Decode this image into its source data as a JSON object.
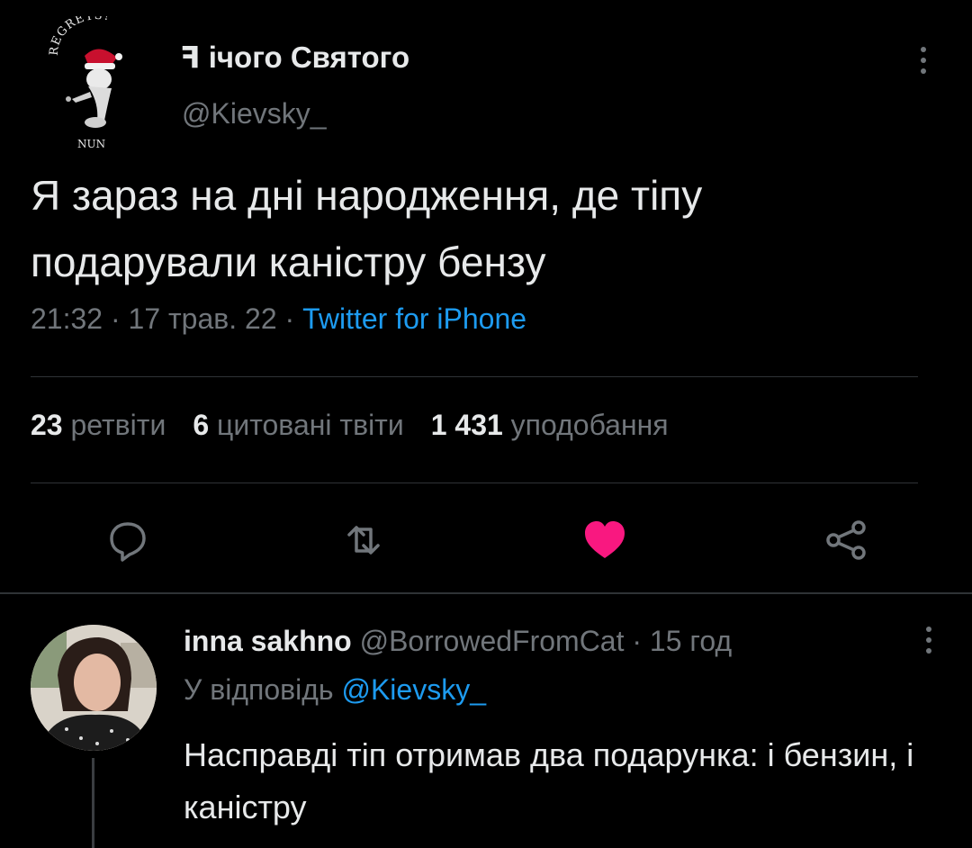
{
  "tweet": {
    "author": {
      "display_name": "ꟻ ічого Святого",
      "handle": "@Kievsky_",
      "avatar_text_top": "REGRETS?",
      "avatar_text_bottom": "NUN"
    },
    "text": "Я зараз на дні народження, де тіпу подарували каністру бензу",
    "time": "21:32",
    "date": "17 трав. 22",
    "source": "Twitter for iPhone",
    "separator": " · ",
    "stats": {
      "retweets_count": "23",
      "retweets_label": "ретвіти",
      "quotes_count": "6",
      "quotes_label": "цитовані твіти",
      "likes_count": "1 431",
      "likes_label": "уподобання"
    },
    "actions": {
      "reply_icon": "reply-icon",
      "retweet_icon": "retweet-icon",
      "like_icon": "heart-icon",
      "share_icon": "share-icon",
      "liked": true,
      "like_color": "#f91880"
    }
  },
  "reply": {
    "display_name": "inna sakhno",
    "handle": "@BorrowedFromCat",
    "age": "15 год",
    "separator": " · ",
    "replying_prefix": "У відповідь",
    "replying_to": "@Kievsky_",
    "text": "Насправді тіп отримав два подарунка: і бензин, і каністру"
  },
  "colors": {
    "background": "#000000",
    "text": "#e7e9ea",
    "muted": "#71767b",
    "accent": "#1d9bf0",
    "like": "#f91880"
  }
}
